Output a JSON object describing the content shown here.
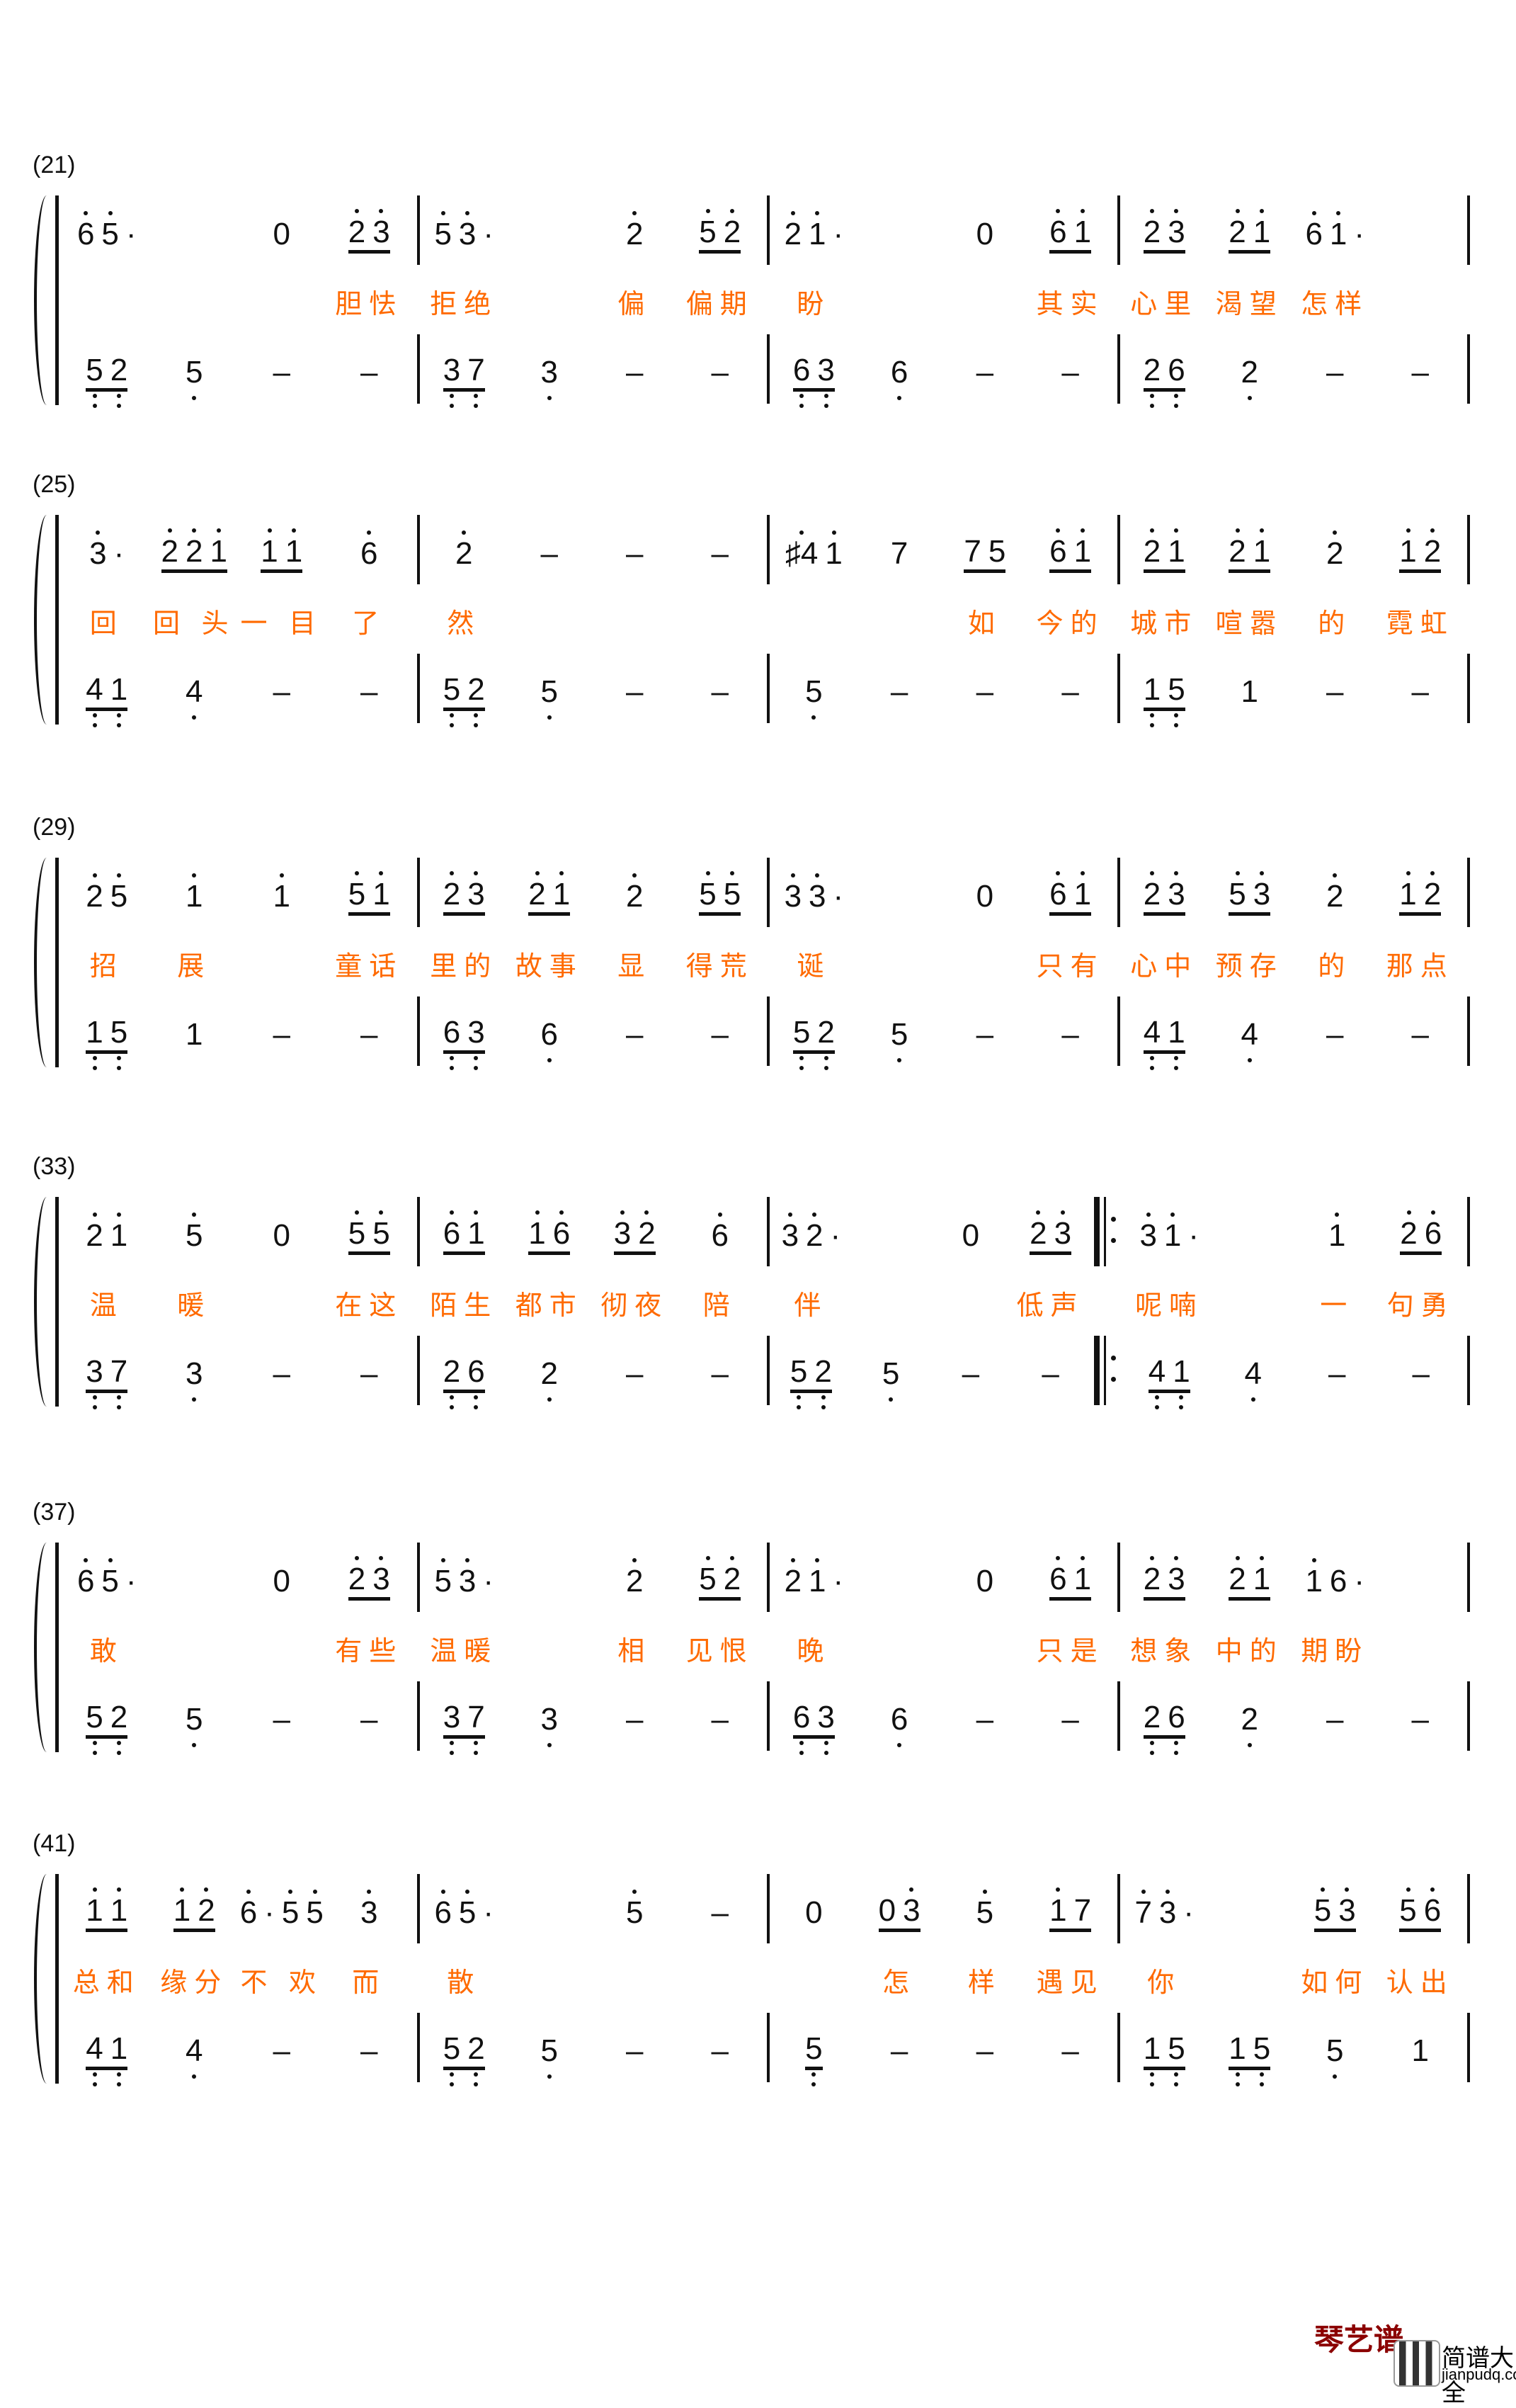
{
  "systems": [
    {
      "label": "(21)",
      "measures": [
        {
          "up": [
            "6'5'·",
            "",
            "0",
            "2' 3'"
          ],
          "ly": [
            "",
            "",
            "",
            "胆怯"
          ],
          "lo": [
            "5,,2,,",
            "5,",
            "–",
            "–"
          ]
        },
        {
          "up": [
            "5'3'·",
            "",
            "2'",
            "5' 2'"
          ],
          "ly": [
            "拒绝",
            "",
            "偏",
            "偏期"
          ],
          "lo": [
            "3,,7,,",
            "3,",
            "–",
            "–"
          ]
        },
        {
          "up": [
            "2'1'·",
            "",
            "0",
            "6' 1'"
          ],
          "ly": [
            "盼",
            "",
            "",
            "其实"
          ],
          "lo": [
            "6,,3,,",
            "6,",
            "–",
            "–"
          ]
        },
        {
          "up": [
            "2' 3'",
            "2' 1'",
            "6'1'·",
            ""
          ],
          "ly": [
            "心里",
            "渴望",
            "怎样",
            ""
          ],
          "lo": [
            "2,,6,,",
            "2,",
            "–",
            "–"
          ]
        }
      ]
    },
    {
      "label": "(25)",
      "measures": [
        {
          "up": [
            "3'·",
            "2'2' 1'",
            "1' 1'",
            "6'"
          ],
          "ly": [
            "回",
            "回 头",
            "一 目",
            "了"
          ],
          "lo": [
            "4,,1,,",
            "4,",
            "–",
            "–"
          ]
        },
        {
          "up": [
            "2'",
            "–",
            "–",
            "–"
          ],
          "ly": [
            "然",
            "",
            "",
            ""
          ],
          "lo": [
            "5,,2,,",
            "5,",
            "–",
            "–"
          ]
        },
        {
          "up": [
            "♯4'1'",
            "7",
            "7 5",
            "6' 1'"
          ],
          "ly": [
            "",
            "",
            "如",
            "今的"
          ],
          "lo": [
            "5,",
            "–",
            "–",
            "–"
          ]
        },
        {
          "up": [
            "2' 1'",
            "2' 1'",
            "2'",
            "1' 2'"
          ],
          "ly": [
            "城市",
            "喧嚣",
            "的",
            "霓虹"
          ],
          "lo": [
            "1,,5,,",
            "1",
            "–",
            "–"
          ]
        }
      ]
    },
    {
      "label": "(29)",
      "measures": [
        {
          "up": [
            "2'5'",
            "1'",
            "1'",
            "5' 1'"
          ],
          "ly": [
            "招",
            "展",
            "",
            "童话"
          ],
          "lo": [
            "1,,5,,",
            "1",
            "–",
            "–"
          ]
        },
        {
          "up": [
            "2' 3'",
            "2' 1'",
            "2'",
            "5' 5'"
          ],
          "ly": [
            "里的",
            "故事",
            "显",
            "得荒"
          ],
          "lo": [
            "6,,3,,",
            "6,",
            "–",
            "–"
          ]
        },
        {
          "up": [
            "3'3'·",
            "",
            "0",
            "6' 1'"
          ],
          "ly": [
            "诞",
            "",
            "",
            "只有"
          ],
          "lo": [
            "5,,2,,",
            "5,",
            "–",
            "–"
          ]
        },
        {
          "up": [
            "2' 3'",
            "5' 3'",
            "2'",
            "1' 2'"
          ],
          "ly": [
            "心中",
            "预存",
            "的",
            "那点"
          ],
          "lo": [
            "4,,1,,",
            "4,",
            "–",
            "–"
          ]
        }
      ]
    },
    {
      "label": "(33)",
      "measures": [
        {
          "up": [
            "2'1'",
            "5'",
            "0",
            "5' 5'"
          ],
          "ly": [
            "温",
            "暖",
            "",
            "在这"
          ],
          "lo": [
            "3,,7,,",
            "3,",
            "–",
            "–"
          ]
        },
        {
          "up": [
            "6' 1'",
            "1' 6'",
            "3' 2'",
            "6'"
          ],
          "ly": [
            "陌生",
            "都市",
            "彻夜",
            "陪"
          ],
          "lo": [
            "2,,6,,",
            "2,",
            "–",
            "–"
          ]
        },
        {
          "up": [
            "3'2'·",
            "",
            "0",
            "2' 3'"
          ],
          "ly": [
            "伴",
            "",
            "",
            "低声"
          ],
          "lo": [
            "5,,2,,",
            "5,",
            "–",
            "–"
          ]
        },
        {
          "up": [
            "3'1'·",
            "",
            "1'",
            "2' 6'"
          ],
          "ly": [
            "呢喃",
            "",
            "一",
            "句勇"
          ],
          "lo": [
            "4,,1,,",
            "4,",
            "–",
            "–"
          ]
        }
      ]
    },
    {
      "label": "(37)",
      "measures": [
        {
          "up": [
            "6'5'·",
            "",
            "0",
            "2' 3'"
          ],
          "ly": [
            "敢",
            "",
            "",
            "有些"
          ],
          "lo": [
            "5,,2,,",
            "5,",
            "–",
            "–"
          ]
        },
        {
          "up": [
            "5'3'·",
            "",
            "2'",
            "5' 2'"
          ],
          "ly": [
            "温暖",
            "",
            "相",
            "见恨"
          ],
          "lo": [
            "3,,7,,",
            "3,",
            "–",
            "–"
          ]
        },
        {
          "up": [
            "2'1'·",
            "",
            "0",
            "6' 1'"
          ],
          "ly": [
            "晚",
            "",
            "",
            "只是"
          ],
          "lo": [
            "6,,3,,",
            "6,",
            "–",
            "–"
          ]
        },
        {
          "up": [
            "2' 3'",
            "2' 1'",
            "1'6·",
            ""
          ],
          "ly": [
            "想象",
            "中的",
            "期盼",
            ""
          ],
          "lo": [
            "2,,6,,",
            "2,",
            "–",
            "–"
          ]
        }
      ]
    },
    {
      "label": "(41)",
      "measures": [
        {
          "up": [
            "1' 1'",
            "1' 2'",
            "6'·5'5'",
            "3'"
          ],
          "ly": [
            "总和",
            "缘分",
            "不 欢",
            "而"
          ],
          "lo": [
            "4,,1,,",
            "4,",
            "–",
            "–"
          ]
        },
        {
          "up": [
            "6'5'·",
            "",
            "5'",
            "–"
          ],
          "ly": [
            "散",
            "",
            "",
            ""
          ],
          "lo": [
            "5,,2,,",
            "5,",
            "–",
            "–"
          ]
        },
        {
          "up": [
            "0",
            "0 3'",
            "5'",
            "1' 7"
          ],
          "ly": [
            "",
            "怎",
            "样",
            "遇见"
          ],
          "lo": [
            "5,,",
            "–",
            "–",
            "–"
          ]
        },
        {
          "up": [
            "7'3'·",
            "",
            "5' 3'",
            "5' 6'"
          ],
          "ly": [
            "你",
            "",
            "如何",
            "认出"
          ],
          "lo": [
            "1,,5,,",
            "1,,5,,",
            "5,",
            "1"
          ]
        }
      ]
    }
  ],
  "logo": {
    "brand_text": "琴艺谱",
    "cn": "简谱大全",
    "url": "jianpudq.com"
  },
  "colors": {
    "lyrics": "#ff6a00",
    "notes": "#111111",
    "logo_red": "#8b0000"
  }
}
